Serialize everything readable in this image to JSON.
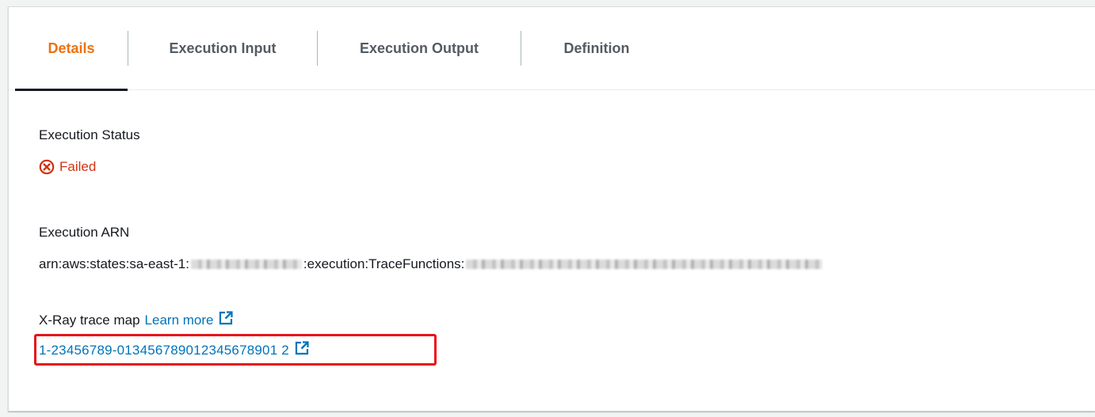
{
  "tabs": [
    {
      "label": "Details",
      "active": true
    },
    {
      "label": "Execution Input",
      "active": false
    },
    {
      "label": "Execution Output",
      "active": false
    },
    {
      "label": "Definition",
      "active": false
    }
  ],
  "details": {
    "status_label": "Execution Status",
    "status_value": "Failed",
    "arn_label": "Execution ARN",
    "arn_prefix": "arn:aws:states:sa-east-1:",
    "arn_middle": ":execution:TraceFunctions:",
    "xray_label": "X-Ray trace map",
    "learn_more": "Learn more",
    "trace_id": "1-23456789-013456789012345678901 2"
  },
  "icons": {
    "status": "error-circle-x-icon",
    "external": "external-link-icon"
  },
  "colors": {
    "active_tab": "#ec7211",
    "error": "#d13212",
    "link": "#0073bb",
    "highlight": "#e8131a"
  }
}
